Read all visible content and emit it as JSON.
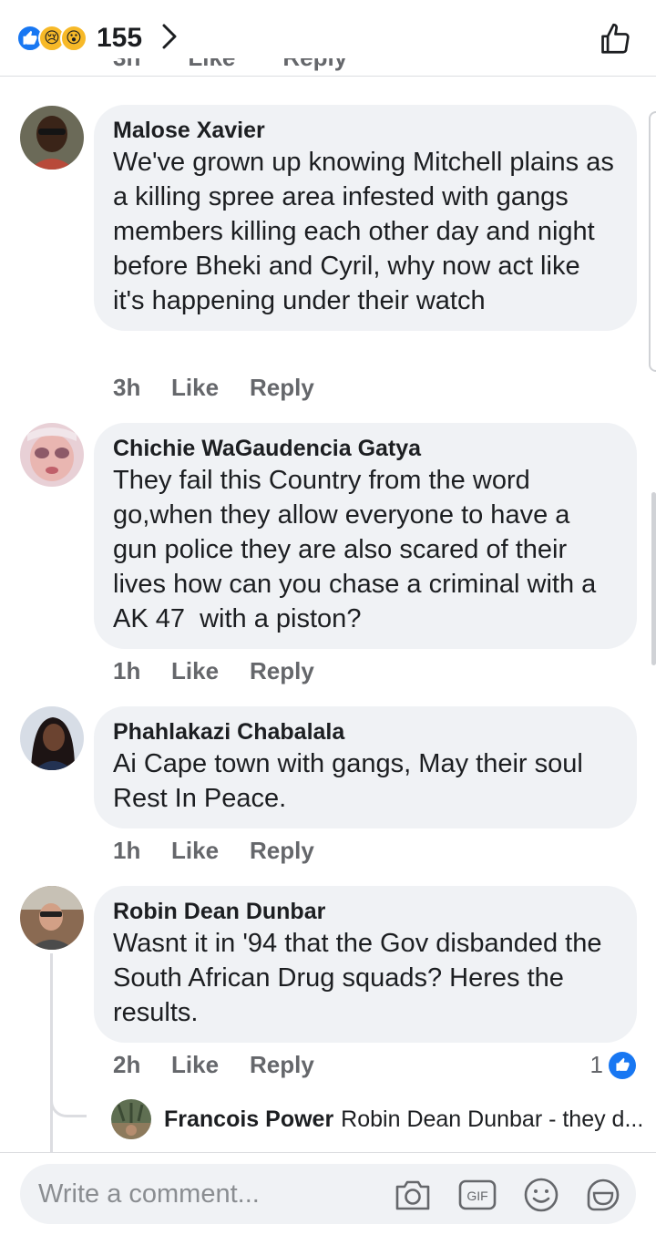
{
  "header": {
    "reaction_count": "155",
    "reactions": [
      "like-reaction",
      "sad-reaction",
      "wow-reaction"
    ]
  },
  "remnant": {
    "time": "3h",
    "like": "Like",
    "reply": "Reply"
  },
  "comments": [
    {
      "author": "Malose Xavier",
      "text": "We've grown up knowing Mitchell plains as a killing spree area infested with gangs members killing each other day and night before Bheki and Cyril, why now act like it's happening under their watch",
      "time": "3h",
      "like": "Like",
      "reply": "Reply"
    },
    {
      "author": "Chichie WaGaudencia Gatya",
      "text": "They fail this Country from the word go,when they allow everyone to have a gun police they are also scared of their lives how can you chase a criminal with a AK 47  with a piston?",
      "time": "1h",
      "like": "Like",
      "reply": "Reply"
    },
    {
      "author": "Phahlakazi Chabalala",
      "text": "Ai Cape town with gangs, May their soul Rest In Peace.",
      "time": "1h",
      "like": "Like",
      "reply": "Reply"
    },
    {
      "author": "Robin Dean Dunbar",
      "text": "Wasnt it in '94 that the Gov disbanded the South African Drug squads? Heres the results.",
      "time": "2h",
      "like": "Like",
      "reply": "Reply",
      "reaction_count": "1"
    }
  ],
  "reply_preview": {
    "author": "Francois Power",
    "text": "Robin Dean Dunbar - they d..."
  },
  "composer": {
    "placeholder": "Write a comment..."
  },
  "colors": {
    "accent": "#1877f2",
    "bubble": "#f0f2f5",
    "secondary_text": "#65676b"
  }
}
